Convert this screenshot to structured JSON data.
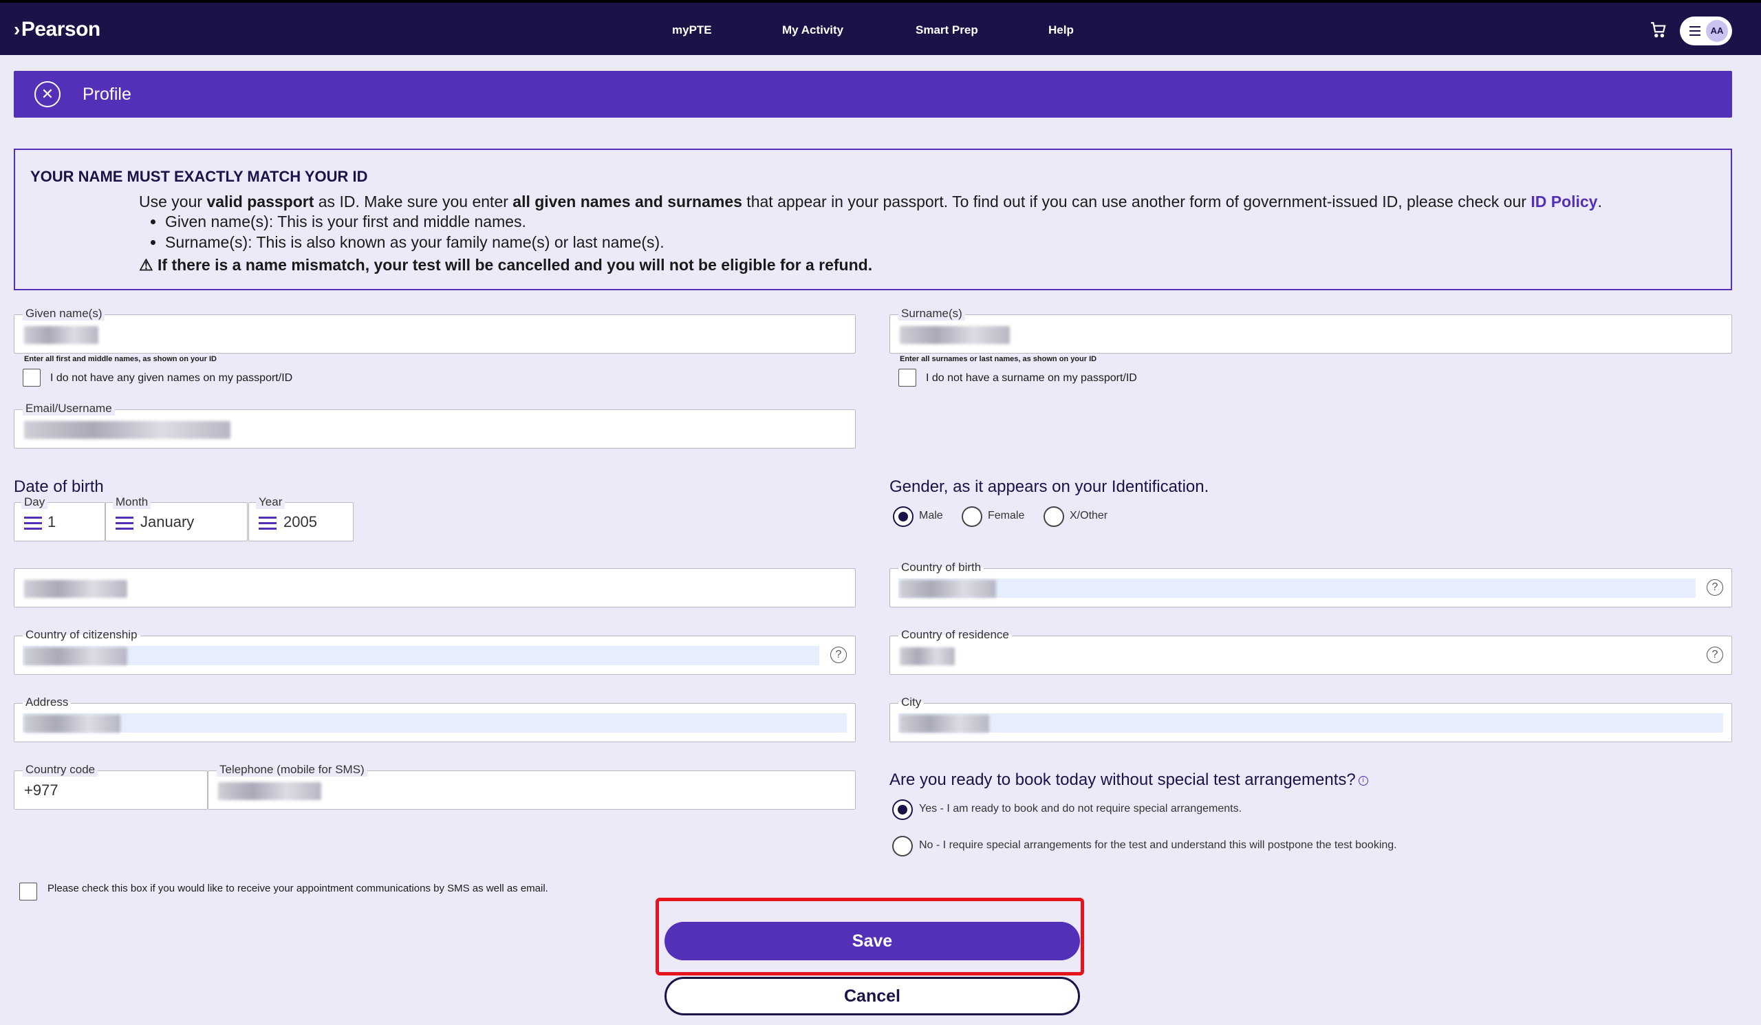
{
  "header": {
    "logo": "Pearson",
    "nav": [
      "myPTE",
      "My Activity",
      "Smart Prep",
      "Help"
    ],
    "avatar_initials": "AA"
  },
  "profile_bar": {
    "title": "Profile"
  },
  "notice": {
    "heading": "YOUR NAME MUST EXACTLY MATCH YOUR ID",
    "line1_a": "Use your ",
    "line1_b": "valid passport",
    "line1_c": " as ID. Make sure you enter ",
    "line1_d": "all given names and surnames",
    "line1_e": " that appear in your passport. To find out if you can use another form of government-issued ID, please check our ",
    "line1_link": "ID Policy",
    "line1_end": ".",
    "bullets": [
      "Given name(s): This is your first and middle names.",
      "Surname(s): This is also known as your family name(s) or last name(s)."
    ],
    "warning": "If there is a name mismatch, your test will be cancelled and you will not be eligible for a refund."
  },
  "form": {
    "given_label": "Given name(s)",
    "given_hint": "Enter all first and middle names, as shown on your ID",
    "given_none": "I do not have any given names on my passport/ID",
    "surname_label": "Surname(s)",
    "surname_hint": "Enter all surnames or last names, as shown on your ID",
    "surname_none": "I do not have a surname on my passport/ID",
    "email_label": "Email/Username",
    "dob_heading": "Date of birth",
    "day_label": "Day",
    "day_value": "1",
    "month_label": "Month",
    "month_value": "January",
    "year_label": "Year",
    "year_value": "2005",
    "gender_heading": "Gender, as it appears on your Identification.",
    "gender_options": [
      "Male",
      "Female",
      "X/Other"
    ],
    "birth_country_label": "Country of birth",
    "citizenship_label": "Country of citizenship",
    "residence_label": "Country of residence",
    "address_label": "Address",
    "city_label": "City",
    "country_code_label": "Country code",
    "country_code_value": "+977",
    "phone_label": "Telephone (mobile for SMS)",
    "ready_heading": "Are you ready to book today without special test arrangements?",
    "ready_yes": "Yes - I am ready to book and do not require special arrangements.",
    "ready_no": "No - I require special arrangements for the test and understand this will postpone the test booking.",
    "sms_label": "Please check this box if you would like to receive your appointment communications by SMS as well as email.",
    "save": "Save",
    "cancel": "Cancel"
  }
}
